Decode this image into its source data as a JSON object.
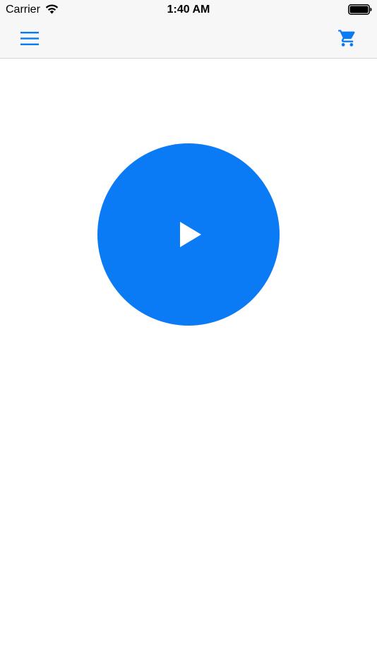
{
  "status_bar": {
    "carrier": "Carrier",
    "time": "1:40 AM",
    "wifi_icon": "wifi-icon",
    "battery_icon": "battery-icon"
  },
  "nav_bar": {
    "menu_icon": "hamburger-menu-icon",
    "cart_icon": "shopping-cart-icon"
  },
  "main": {
    "play_icon": "play-icon"
  },
  "colors": {
    "accent": "#0a7bf5",
    "bar_background": "#f7f7f7",
    "background": "#ffffff"
  }
}
